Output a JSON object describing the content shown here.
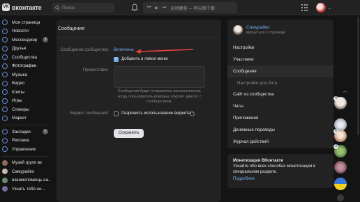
{
  "header": {
    "logo_text": "вконтакте",
    "search_placeholder": "Поиск",
    "player_track": "运动健身 — 阿以丽千面"
  },
  "sidebar": {
    "items": [
      {
        "label": "Моя страница"
      },
      {
        "label": "Новости"
      },
      {
        "label": "Мессенджер",
        "badge": "3"
      },
      {
        "label": "Друзья"
      },
      {
        "label": "Сообщества"
      },
      {
        "label": "Фотографии"
      },
      {
        "label": "Музыка"
      },
      {
        "label": "Видео"
      },
      {
        "label": "Клипы"
      },
      {
        "label": "Игры"
      },
      {
        "label": "Стикеры"
      },
      {
        "label": "Маркет"
      }
    ],
    "items2": [
      {
        "label": "Закладки",
        "badge": "2"
      },
      {
        "label": "Реклама"
      },
      {
        "label": "Управление"
      }
    ],
    "items3": [
      {
        "label": "Музей групп вк"
      },
      {
        "label": "Самурайко"
      },
      {
        "label": "взаимопомощь на..."
      },
      {
        "label": "Узнать тебя не..."
      }
    ]
  },
  "main": {
    "title": "Сообщения",
    "status_label": "Сообщения сообщества:",
    "status_value": "Включены",
    "add_left_menu": "Добавить в левое меню",
    "greeting_label": "Приветствие:",
    "greeting_hint": "Сообщения будет отправлено автоматически, когда пользователь впервые откроет диалог с сообществом.",
    "widget_label": "Виджет сообщений:",
    "widget_checkbox": "Разрешить использование виджета",
    "save_label": "Сохранить"
  },
  "right": {
    "community_name": "Самурайко",
    "back_link": "вернуться к странице",
    "menu": [
      {
        "label": "Настройки"
      },
      {
        "label": "Участники"
      },
      {
        "label": "Сообщения",
        "active": true
      },
      {
        "label": "Настройки для бота",
        "sub": true
      },
      {
        "label": "Сайт из сообщества"
      },
      {
        "label": "Чаты"
      },
      {
        "label": "Приложения"
      },
      {
        "label": "Денежные переводы"
      },
      {
        "label": "Журнал действий"
      }
    ],
    "monet_title": "Монетизация ВКонтакте",
    "monet_desc": "Узнайте обо всех способах монетизации в специальном разделе.",
    "monet_link": "Подробнее"
  },
  "chat_strip": {
    "badges": [
      "4",
      "6",
      "3"
    ]
  },
  "colors": {
    "accent": "#71aaeb",
    "arrow": "#e8413c",
    "panel": "#222222",
    "bg": "#141414"
  }
}
